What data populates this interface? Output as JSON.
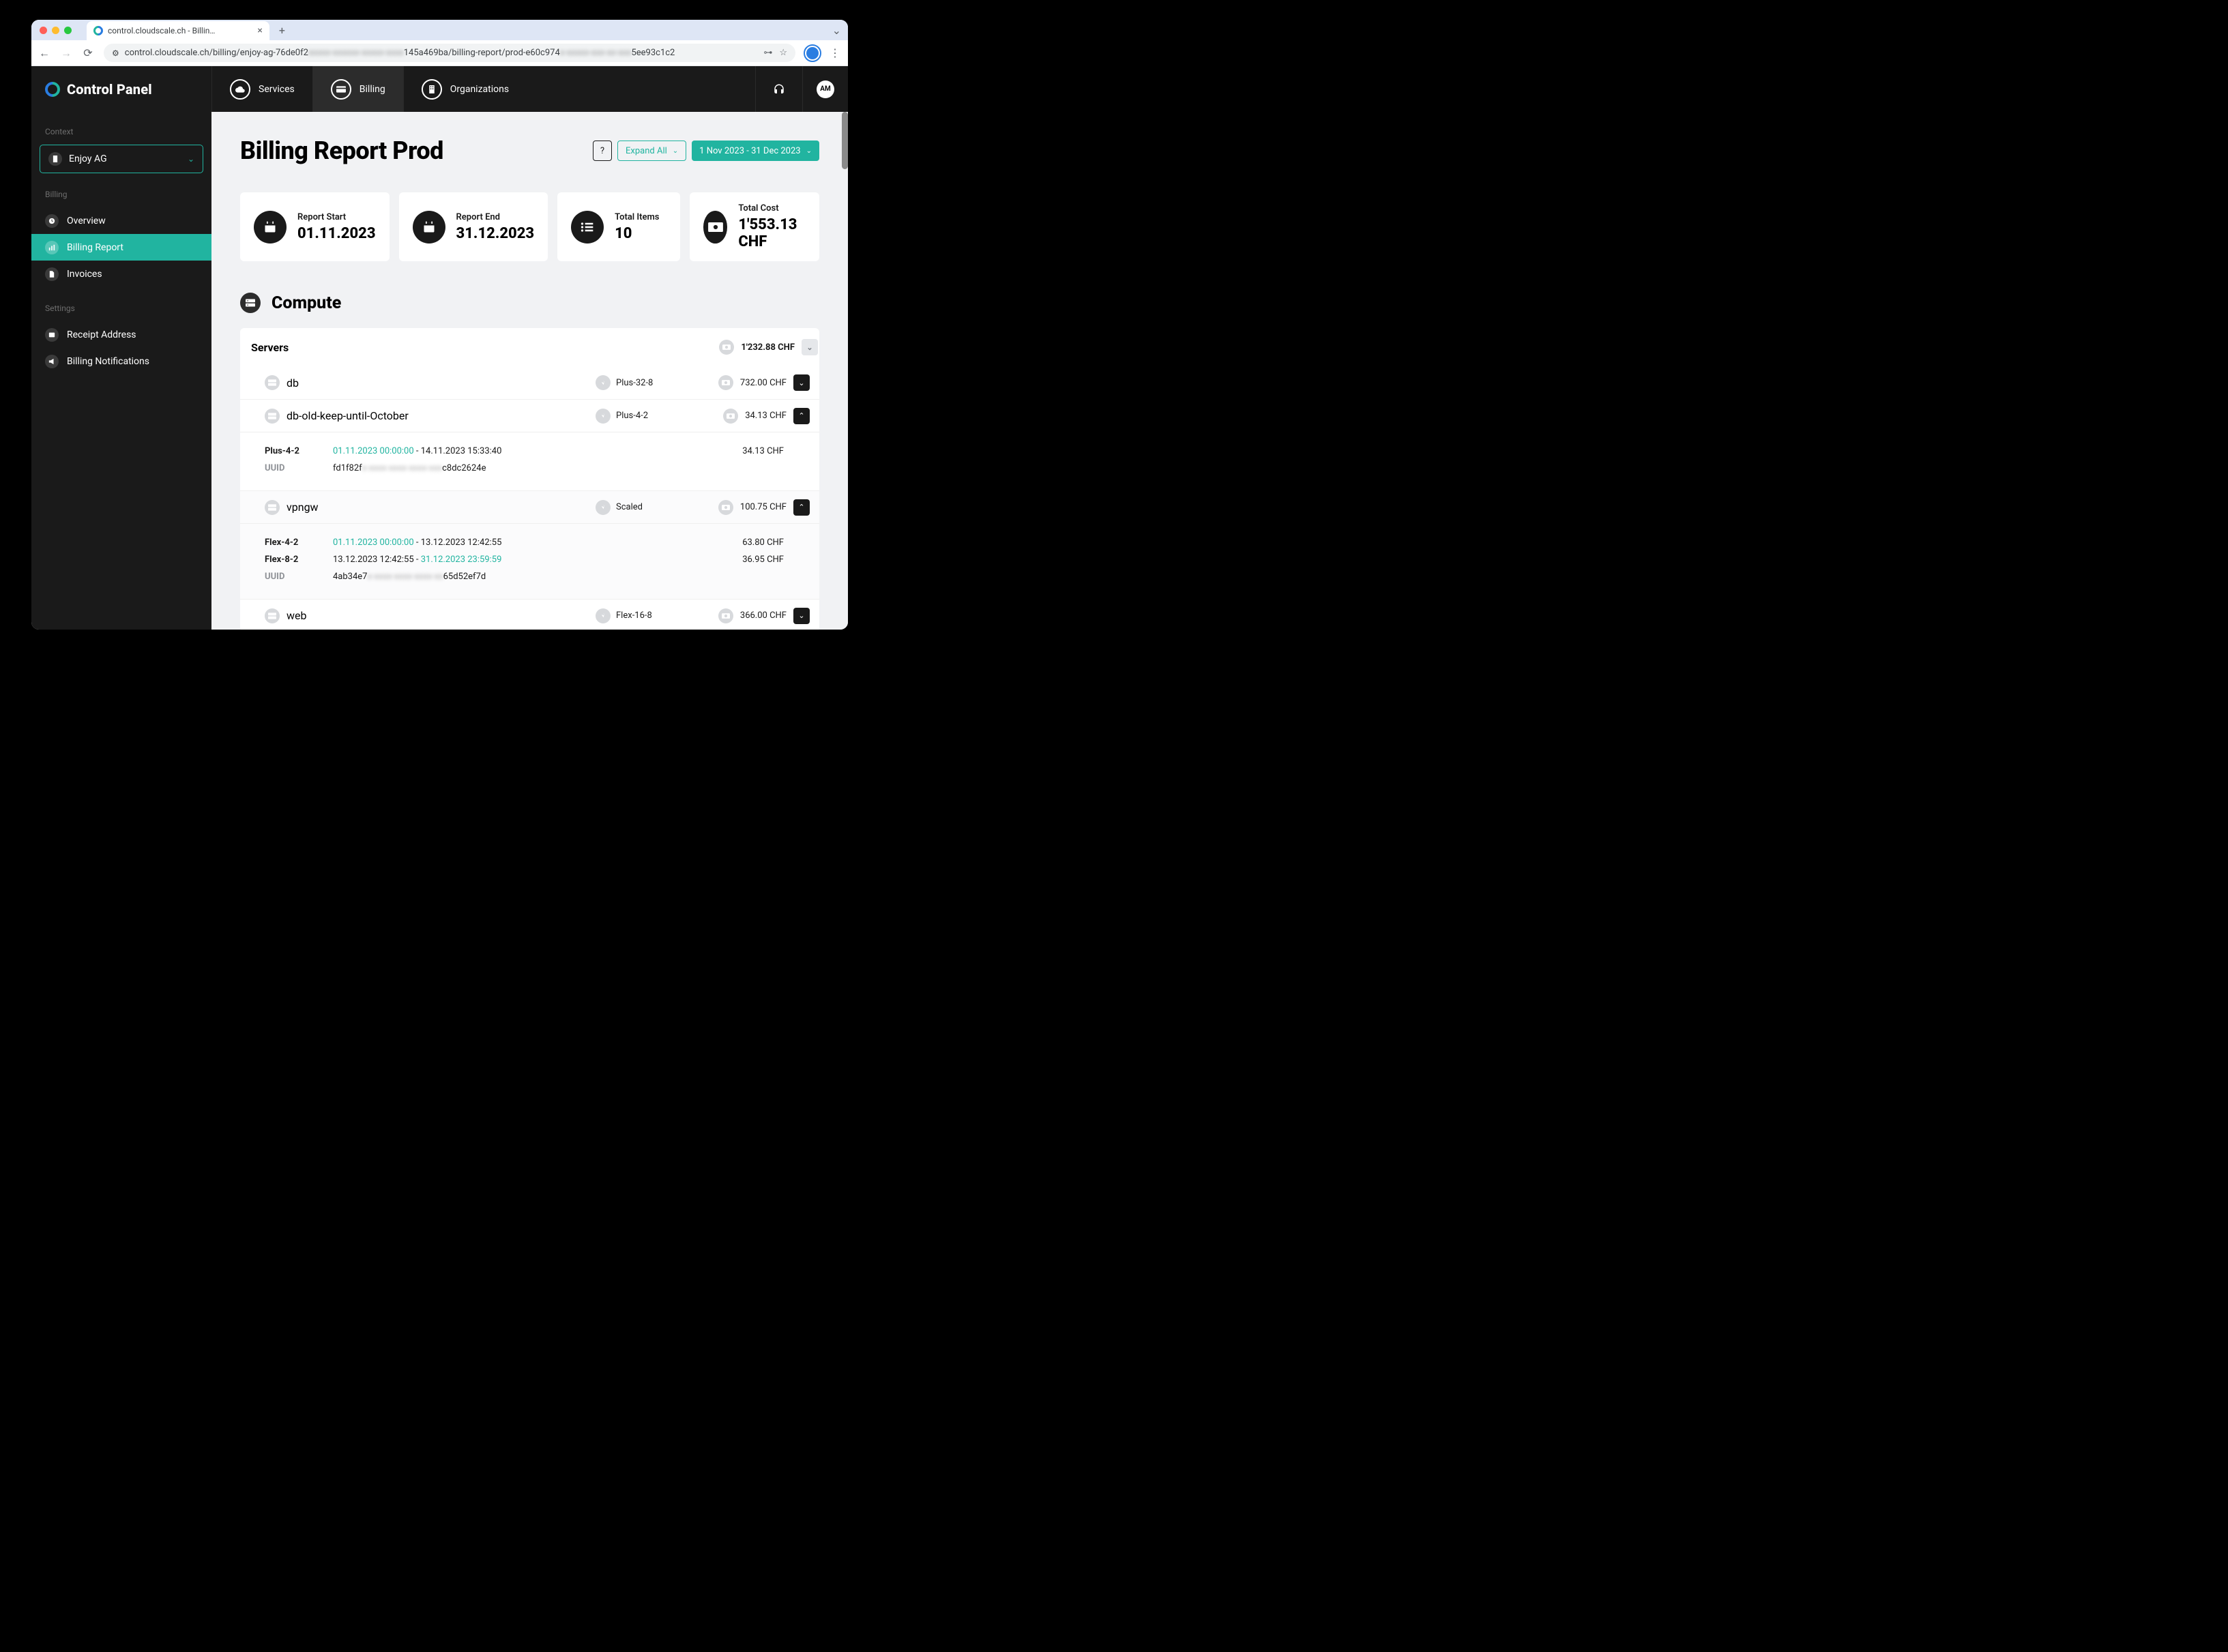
{
  "browser": {
    "tab_title": "control.cloudscale.ch - Billin…",
    "url_prefix": "control.cloudscale.ch/billing/enjoy-ag-76de0f2",
    "url_blur1": "xxxxx-xxxxxx-xxxxx-xxxx",
    "url_mid": "145a469ba/billing-report/prod-e60c974",
    "url_blur2": "x-xxxxx-xxx-xx-xxx",
    "url_suffix": "5ee93c1c2"
  },
  "topnav": {
    "brand": "Control Panel",
    "items": [
      "Services",
      "Billing",
      "Organizations"
    ],
    "active_index": 1,
    "avatar_initials": "AM"
  },
  "sidebar": {
    "context_label": "Context",
    "context_value": "Enjoy AG",
    "billing_label": "Billing",
    "billing_items": [
      "Overview",
      "Billing Report",
      "Invoices"
    ],
    "billing_active_index": 1,
    "settings_label": "Settings",
    "settings_items": [
      "Receipt Address",
      "Billing Notifications"
    ]
  },
  "page": {
    "title": "Billing Report Prod",
    "help": "?",
    "expand_all": "Expand All",
    "date_range": "1 Nov 2023 - 31 Dec 2023"
  },
  "summary": {
    "cards": [
      {
        "label": "Report Start",
        "value": "01.11.2023"
      },
      {
        "label": "Report End",
        "value": "31.12.2023"
      },
      {
        "label": "Total Items",
        "value": "10"
      },
      {
        "label": "Total Cost",
        "value": "1'553.13 CHF"
      }
    ]
  },
  "compute": {
    "title": "Compute",
    "servers_label": "Servers",
    "servers_total": "1'232.88 CHF",
    "rows": [
      {
        "name": "db",
        "flavor": "Plus-32-8",
        "cost": "732.00 CHF",
        "expanded": false
      },
      {
        "name": "db-old-keep-until-October",
        "flavor": "Plus-4-2",
        "cost": "34.13 CHF",
        "expanded": true,
        "detail": {
          "entries": [
            {
              "flavor": "Plus-4-2",
              "start": "01.11.2023 00:00:00",
              "end": "14.11.2023 15:33:40",
              "start_green": true,
              "end_green": false,
              "cost": "34.13 CHF"
            }
          ],
          "uuid_label": "UUID",
          "uuid_pre": "fd1f82f",
          "uuid_blur": "x-xxxx-xxxx-xxxx-xxx",
          "uuid_suf": "c8dc2624e"
        }
      },
      {
        "name": "vpngw",
        "flavor": "Scaled",
        "cost": "100.75 CHF",
        "expanded": true,
        "alt": true,
        "detail": {
          "entries": [
            {
              "flavor": "Flex-4-2",
              "start": "01.11.2023 00:00:00",
              "end": "13.12.2023 12:42:55",
              "start_green": true,
              "end_green": false,
              "cost": "63.80 CHF"
            },
            {
              "flavor": "Flex-8-2",
              "start": "13.12.2023 12:42:55",
              "end": "31.12.2023 23:59:59",
              "start_green": false,
              "end_green": true,
              "cost": "36.95 CHF"
            }
          ],
          "uuid_label": "UUID",
          "uuid_pre": "4ab34e7",
          "uuid_blur": "x-xxxx-xxxx-xxxx-xx",
          "uuid_suf": "65d52ef7d"
        }
      },
      {
        "name": "web",
        "flavor": "Flex-16-8",
        "cost": "366.00 CHF",
        "expanded": false
      }
    ]
  }
}
